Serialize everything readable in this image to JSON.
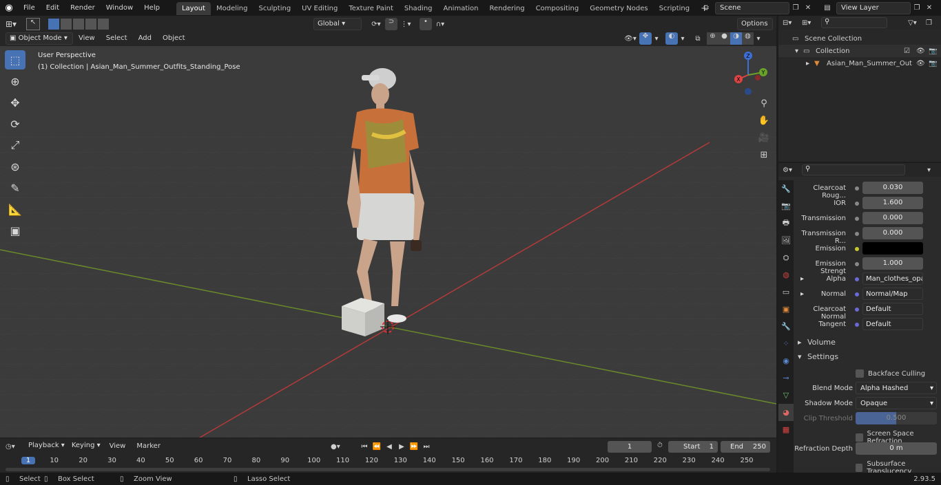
{
  "topbar": {
    "menus": [
      "File",
      "Edit",
      "Render",
      "Window",
      "Help"
    ],
    "workspaces": [
      "Layout",
      "Modeling",
      "Sculpting",
      "UV Editing",
      "Texture Paint",
      "Shading",
      "Animation",
      "Rendering",
      "Compositing",
      "Geometry Nodes",
      "Scripting"
    ],
    "active_workspace": "Layout",
    "add_tab": "+",
    "scene": "Scene",
    "view_layer": "View Layer"
  },
  "viewport_header": {
    "mode": "Object Mode",
    "menus": [
      "View",
      "Select",
      "Add",
      "Object"
    ],
    "transform": "Global",
    "options": "Options"
  },
  "viewport": {
    "perspective": "User Perspective",
    "collection_info": "(1) Collection | Asian_Man_Summer_Outfits_Standing_Pose",
    "gizmo": {
      "x": "X",
      "y": "Y",
      "z": "Z"
    }
  },
  "outliner": {
    "scene_collection": "Scene Collection",
    "collection": "Collection",
    "object": "Asian_Man_Summer_Out"
  },
  "properties": {
    "fields": [
      {
        "label": "Clearcoat Roug...",
        "value": "0.030"
      },
      {
        "label": "IOR",
        "value": "1.600"
      },
      {
        "label": "Transmission",
        "value": "0.000"
      },
      {
        "label": "Transmission R...",
        "value": "0.000"
      },
      {
        "label": "Emission",
        "value": ""
      },
      {
        "label": "Emission Strengt",
        "value": "1.000"
      },
      {
        "label": "Alpha",
        "value": "Man_clothes_opacit..."
      },
      {
        "label": "Normal",
        "value": "Normal/Map"
      },
      {
        "label": "Clearcoat Normal",
        "value": "Default"
      },
      {
        "label": "Tangent",
        "value": "Default"
      }
    ],
    "volume": "Volume",
    "settings": "Settings",
    "backface_culling": "Backface Culling",
    "blend_mode_label": "Blend Mode",
    "blend_mode": "Alpha Hashed",
    "shadow_mode_label": "Shadow Mode",
    "shadow_mode": "Opaque",
    "clip_threshold_label": "Clip Threshold",
    "clip_threshold": "0.500",
    "screen_space_refraction": "Screen Space Refraction",
    "refraction_depth_label": "Refraction Depth",
    "refraction_depth": "0 m",
    "subsurface_translucency": "Subsurface Translucency"
  },
  "timeline": {
    "menus": [
      "Playback",
      "Keying",
      "View",
      "Marker"
    ],
    "current_frame": "1",
    "start_label": "Start",
    "start": "1",
    "end_label": "End",
    "end": "250",
    "ticks": [
      "1",
      "10",
      "20",
      "30",
      "40",
      "50",
      "60",
      "70",
      "80",
      "90",
      "100",
      "110",
      "120",
      "130",
      "140",
      "150",
      "160",
      "170",
      "180",
      "190",
      "200",
      "210",
      "220",
      "230",
      "240",
      "250"
    ]
  },
  "status": {
    "select": "Select",
    "box_select": "Box Select",
    "zoom_view": "Zoom View",
    "lasso_select": "Lasso Select",
    "version": "2.93.5"
  }
}
